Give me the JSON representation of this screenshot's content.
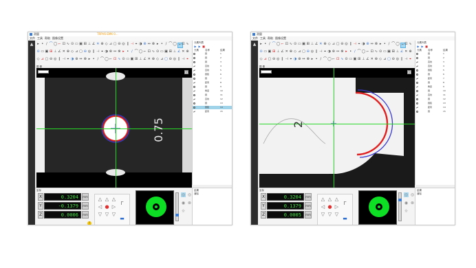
{
  "screenshots": [
    {
      "app_title": "测量",
      "window_title": "TRPV6-EMK 0...",
      "menu": [
        "文件",
        "工具",
        "帮助",
        "图像设置"
      ],
      "image_label": "图 像",
      "ring_label": "0.75",
      "right_panel": {
        "title": "元素列表",
        "headers": [
          "元素",
          "名称",
          "结果"
        ],
        "rows": [
          {
            "icon": "circle",
            "name": "圆",
            "result": "1"
          },
          {
            "icon": "circle",
            "name": "圆",
            "result": "2"
          },
          {
            "icon": "circle",
            "name": "圆",
            "result": "3"
          },
          {
            "icon": "line",
            "name": "直线",
            "result": "4"
          },
          {
            "icon": "line",
            "name": "直线",
            "result": "5"
          },
          {
            "icon": "circle",
            "name": "圆弧",
            "result": "6"
          },
          {
            "icon": "circle",
            "name": "圆",
            "result": "7"
          },
          {
            "icon": "line",
            "name": "距离",
            "result": "8"
          },
          {
            "icon": "circle",
            "name": "圆",
            "result": "9"
          },
          {
            "icon": "line",
            "name": "角度",
            "result": "10"
          },
          {
            "icon": "circle",
            "name": "圆",
            "result": "11"
          },
          {
            "icon": "line",
            "name": "直线",
            "result": "12"
          },
          {
            "icon": "circle",
            "name": "圆",
            "result": "13"
          },
          {
            "icon": "circle",
            "name": "圆弧",
            "result": "14"
          },
          {
            "icon": "line",
            "name": "距离",
            "result": "15"
          }
        ],
        "selected_row": 13
      },
      "dro": {
        "title": "坐标",
        "axes": [
          {
            "label": "X",
            "value": "0.3204",
            "zero": "mm"
          },
          {
            "label": "Y",
            "value": "-0.1379",
            "zero": "mm"
          },
          {
            "label": "Z",
            "value": "0.0006",
            "zero": "mm"
          }
        ]
      },
      "results": {
        "title": "结果",
        "button": "清除"
      }
    },
    {
      "app_title": "测量",
      "window_title": "",
      "menu": [
        "文件",
        "工具",
        "帮助",
        "图像设置"
      ],
      "image_label": "图 像",
      "ring_label": "2",
      "right_panel": {
        "title": "元素列表",
        "headers": [
          "元素",
          "名称",
          "结果"
        ],
        "rows": [
          {
            "icon": "circle",
            "name": "圆",
            "result": "1"
          },
          {
            "icon": "circle",
            "name": "圆",
            "result": "2"
          },
          {
            "icon": "line",
            "name": "直线",
            "result": "3"
          },
          {
            "icon": "line",
            "name": "直线",
            "result": "4"
          },
          {
            "icon": "circle",
            "name": "圆弧",
            "result": "5"
          },
          {
            "icon": "circle",
            "name": "圆",
            "result": "6"
          },
          {
            "icon": "line",
            "name": "距离",
            "result": "7"
          },
          {
            "icon": "circle",
            "name": "圆",
            "result": "8"
          },
          {
            "icon": "line",
            "name": "角度",
            "result": "9"
          },
          {
            "icon": "circle",
            "name": "圆",
            "result": "10"
          },
          {
            "icon": "line",
            "name": "直线",
            "result": "11"
          },
          {
            "icon": "circle",
            "name": "圆",
            "result": "12"
          },
          {
            "icon": "circle",
            "name": "圆弧",
            "result": "13"
          },
          {
            "icon": "line",
            "name": "距离",
            "result": "14"
          },
          {
            "icon": "circle",
            "name": "圆",
            "result": "15"
          }
        ],
        "selected_row": 15
      },
      "dro": {
        "title": "坐标",
        "axes": [
          {
            "label": "X",
            "value": "0.3204",
            "zero": "mm"
          },
          {
            "label": "Y",
            "value": "0.1379",
            "zero": "mm"
          },
          {
            "label": "Z",
            "value": "0.0005",
            "zero": "mm"
          }
        ]
      },
      "results": {
        "title": "结果",
        "button": "清除"
      }
    }
  ],
  "colors": {
    "crosshair": "#26d926",
    "dro_text": "#3fe03f",
    "ring_light": "#0ddf24",
    "selection": "#9ed3ea",
    "fit_circle": "#3a3ad0",
    "edge_red": "#e02020"
  }
}
